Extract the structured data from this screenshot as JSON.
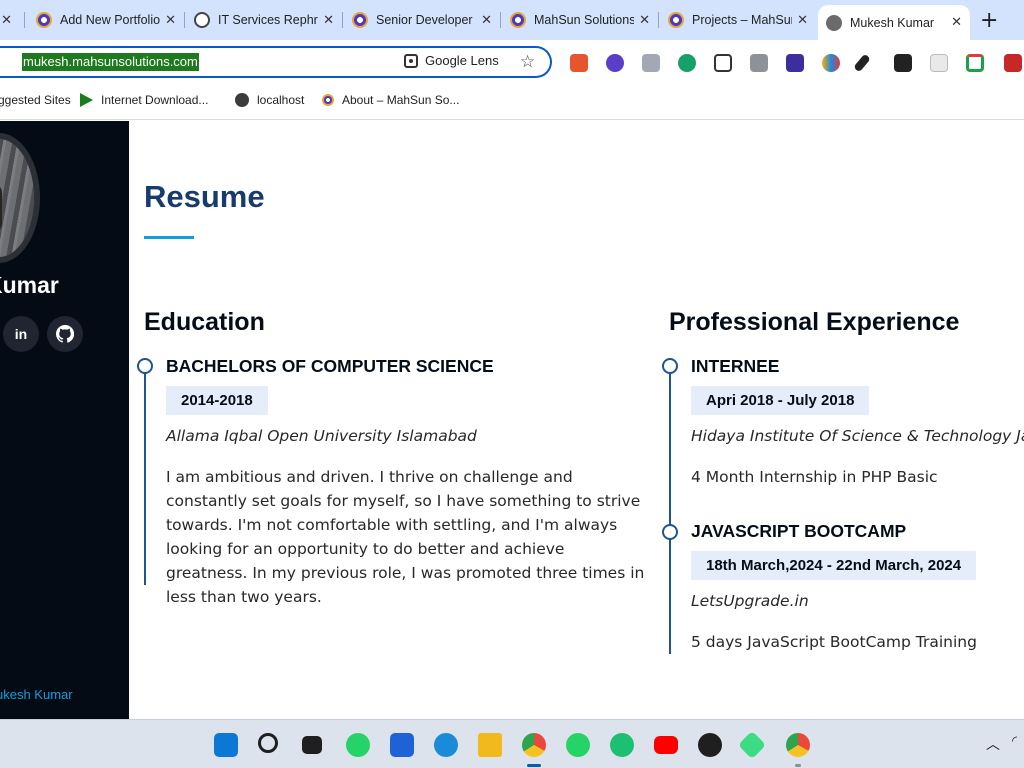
{
  "browser": {
    "tabs": [
      {
        "label": "Add New Portfolio",
        "icon": "mahsun-favicon"
      },
      {
        "label": "IT Services Rephrase",
        "icon": "openai-favicon"
      },
      {
        "label": "Senior Developer",
        "icon": "mahsun-favicon"
      },
      {
        "label": "MahSun Solutions",
        "icon": "mahsun-favicon"
      },
      {
        "label": "Projects – MahSun",
        "icon": "mahsun-favicon"
      },
      {
        "label": "Mukesh Kumar",
        "icon": "globe-favicon",
        "active": true
      }
    ],
    "first_tab_close": "✕",
    "tab_close": "✕",
    "new_tab": "+",
    "url": "mukesh.mahsunsolutions.com",
    "lens_label": "Google Lens",
    "bookmark_star": "☆",
    "bookmarks": [
      {
        "label": "ggested Sites",
        "icon": "suggested-sites-icon"
      },
      {
        "label": "Internet Download...",
        "icon": "idm-icon"
      },
      {
        "label": "localhost",
        "icon": "globe-icon"
      },
      {
        "label": "About – MahSun So...",
        "icon": "mahsun-favicon"
      }
    ]
  },
  "sidebar": {
    "name": "Kumar",
    "social": [
      {
        "label": "in",
        "icon": "linkedin-icon"
      },
      {
        "label": "",
        "icon": "github-icon"
      }
    ],
    "footer": "ukesh Kumar"
  },
  "resume": {
    "title": "Resume",
    "education": {
      "heading": "Education",
      "items": [
        {
          "title": "BACHELORS OF COMPUTER SCIENCE",
          "date": "2014-2018",
          "org": "Allama Iqbal Open University Islamabad",
          "description": "I am ambitious and driven. I thrive on challenge and constantly set goals for myself, so I have something to strive towards. I'm not comfortable with settling, and I'm always looking for an opportunity to do better and achieve greatness. In my previous role, I was promoted three times in less than two years."
        }
      ]
    },
    "experience": {
      "heading": "Professional Experience",
      "items": [
        {
          "title": "INTERNEE",
          "date": "Apri 2018 - July 2018",
          "org": "Hidaya Institute Of Science & Technology Jamshoro",
          "description": "4 Month Internship in PHP Basic"
        },
        {
          "title": "JAVASCRIPT BOOTCAMP",
          "date": "18th March,2024 - 22nd March, 2024",
          "org": "LetsUpgrade.in",
          "description": "5 days JavaScript BootCamp Training"
        }
      ]
    }
  },
  "taskbar": {
    "apps": [
      {
        "icon": "windows-start-icon",
        "color": "#0a78d4"
      },
      {
        "icon": "search-icon",
        "color": "#1f1f1f"
      },
      {
        "icon": "task-view-icon",
        "color": "#1f1f1f"
      },
      {
        "icon": "whatsapp-desktop-icon",
        "color": "#25d366"
      },
      {
        "icon": "microsoft-store-icon",
        "color": "#1e62d6"
      },
      {
        "icon": "edge-icon",
        "color": "#1a8bd8"
      },
      {
        "icon": "file-explorer-icon",
        "color": "#f2b91c"
      },
      {
        "icon": "chrome-icon",
        "color": "#e9483d",
        "active": true
      },
      {
        "icon": "whatsapp-icon",
        "color": "#25d366"
      },
      {
        "icon": "fiverr-icon",
        "color": "#1dbf73"
      },
      {
        "icon": "youtube-icon",
        "color": "#ff0000"
      },
      {
        "icon": "github-icon",
        "color": "#1f1f1f"
      },
      {
        "icon": "android-studio-icon",
        "color": "#3ddc84"
      },
      {
        "icon": "chrome-profile-icon",
        "color": "#e9483d"
      }
    ],
    "tray_chevron": "︿"
  },
  "colors": {
    "accent": "#149ddd",
    "heading": "#173b6c",
    "timeline": "#1f5297",
    "date_bg": "#e4edf9",
    "sidebar_bg": "#040b14"
  }
}
